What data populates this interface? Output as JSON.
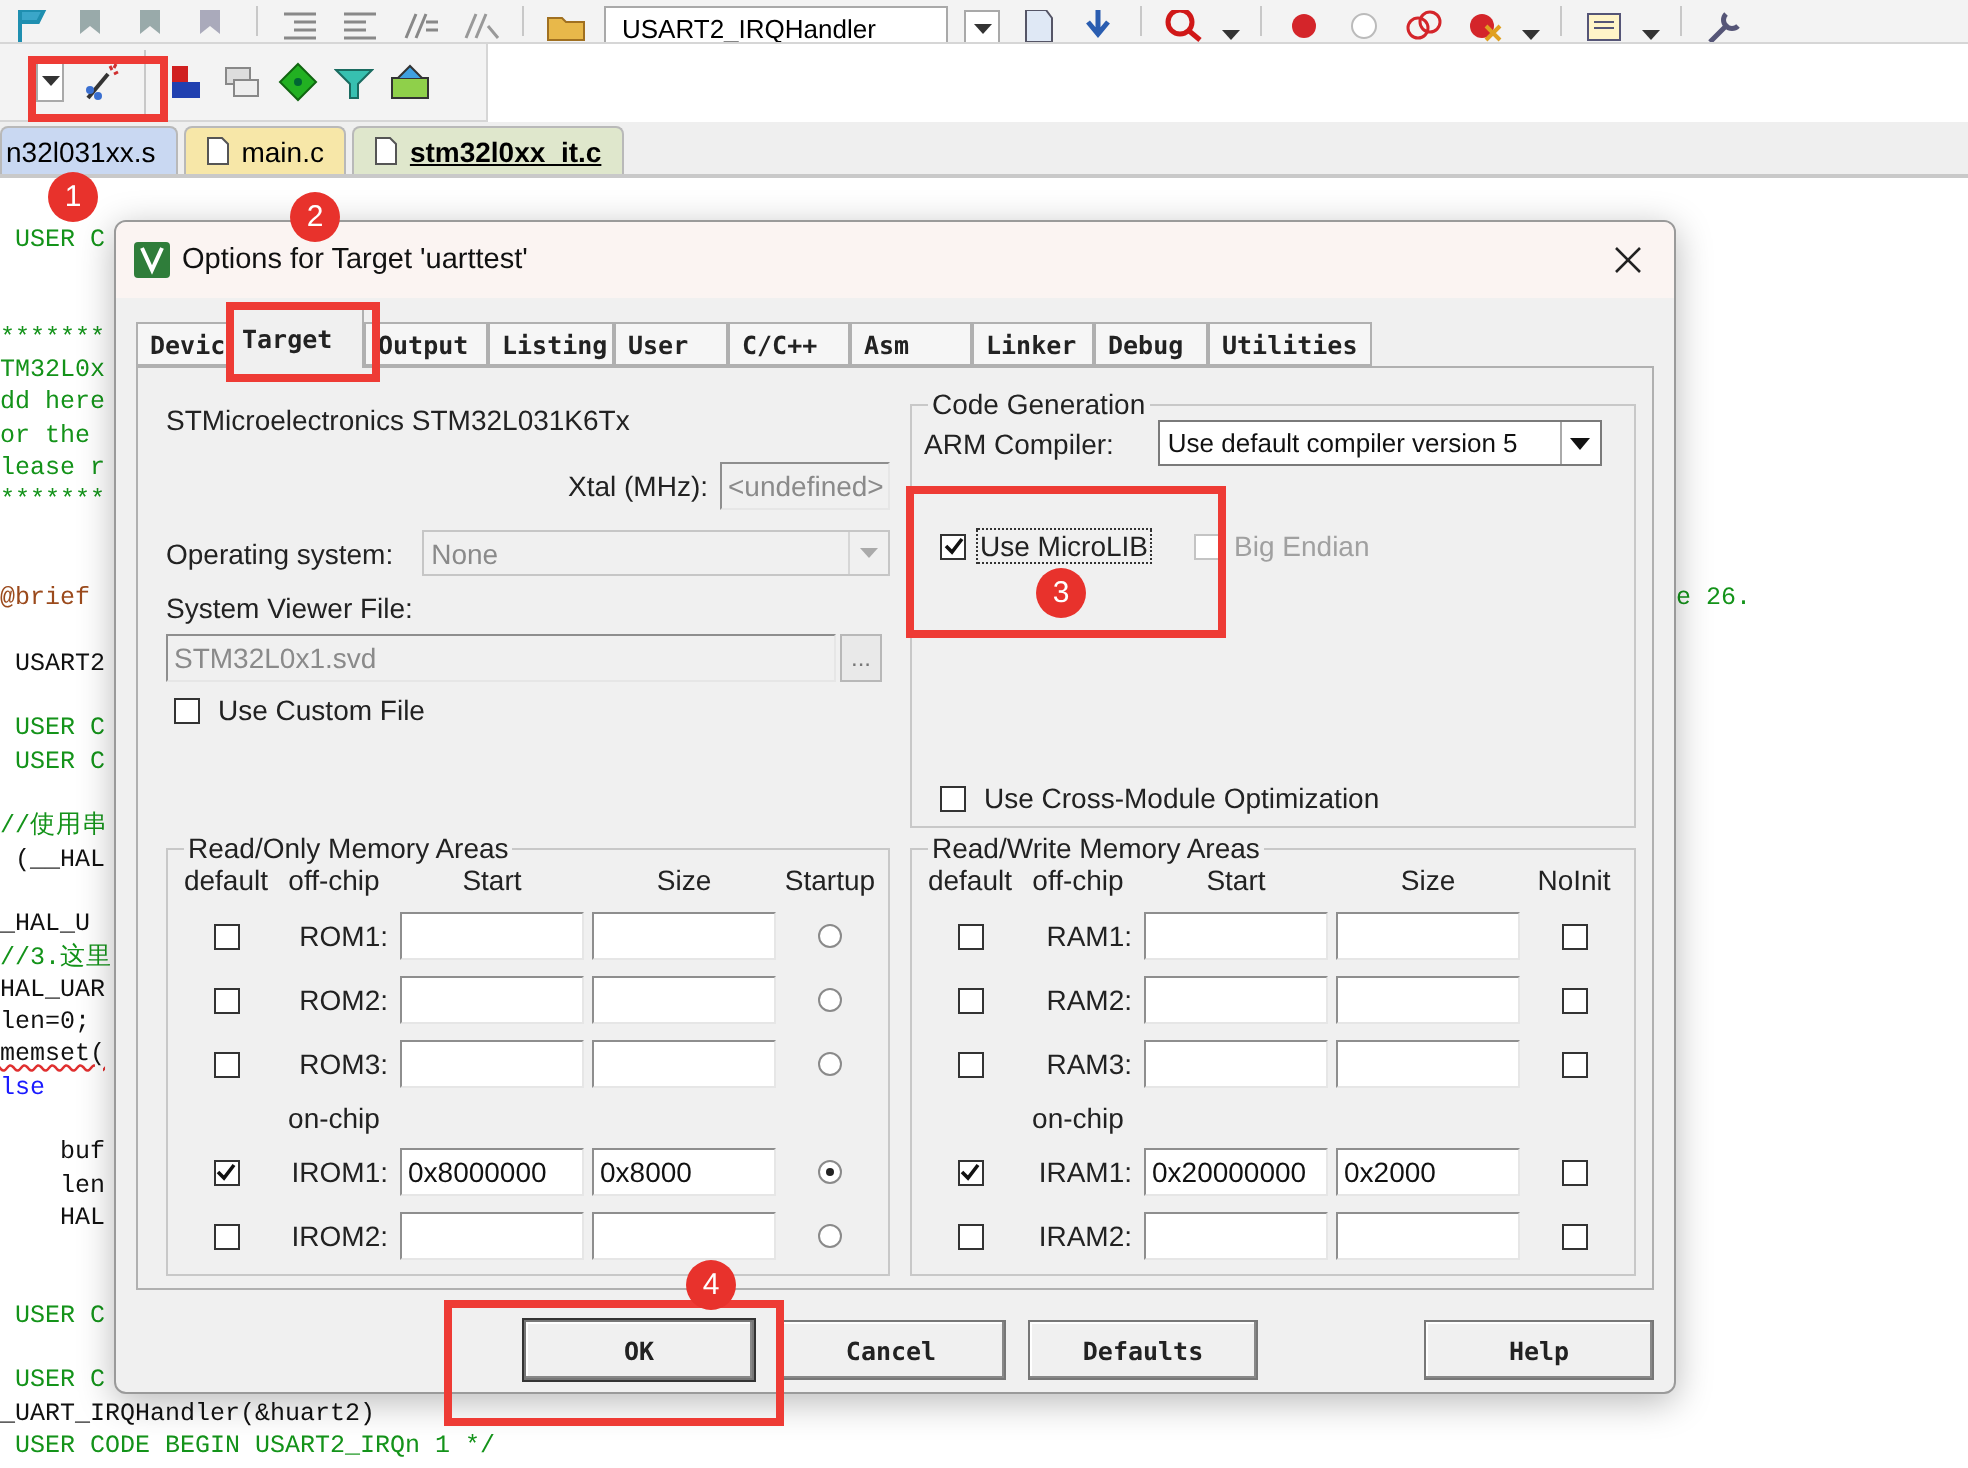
{
  "toolbar": {
    "function_box": "USART2_IRQHandler"
  },
  "file_tabs": [
    {
      "label": "n32l031xx.s",
      "selected": false,
      "color": "#c9d8f2"
    },
    {
      "label": "main.c",
      "selected": false,
      "color": "#f7e7a8"
    },
    {
      "label": "stm32l0xx_it.c",
      "selected": true,
      "color": "#dfe7cc"
    }
  ],
  "code_lines": [
    {
      "kind": "comment",
      "text": " USER C"
    },
    {
      "kind": "blank"
    },
    {
      "kind": "blank"
    },
    {
      "kind": "comment",
      "text": "*******"
    },
    {
      "kind": "comment",
      "text": "TM32L0x"
    },
    {
      "kind": "comment",
      "text": "dd here"
    },
    {
      "kind": "comment",
      "text": "or the"
    },
    {
      "kind": "comment",
      "text": "lease r"
    },
    {
      "kind": "comment",
      "text": "*******"
    },
    {
      "kind": "blank"
    },
    {
      "kind": "blank"
    },
    {
      "kind": "brief",
      "text": "@brief",
      "right_text": "e 26."
    },
    {
      "kind": "blank"
    },
    {
      "kind": "code",
      "text": " USART2"
    },
    {
      "kind": "blank"
    },
    {
      "kind": "comment",
      "text": " USER C"
    },
    {
      "kind": "comment",
      "text": " USER C"
    },
    {
      "kind": "blank"
    },
    {
      "kind": "comment",
      "text": "//使用串"
    },
    {
      "kind": "code",
      "text": " (__HAL"
    },
    {
      "kind": "blank"
    },
    {
      "kind": "code",
      "text": "_HAL_U"
    },
    {
      "kind": "comment",
      "text": "//3.这里"
    },
    {
      "kind": "code",
      "text": "HAL_UAR"
    },
    {
      "kind": "code",
      "text": "len=0;"
    },
    {
      "kind": "error",
      "text": "memset("
    },
    {
      "kind": "keyword",
      "text": "lse"
    },
    {
      "kind": "blank"
    },
    {
      "kind": "code",
      "text": "    buf"
    },
    {
      "kind": "code",
      "text": "    len"
    },
    {
      "kind": "code",
      "text": "    HAL"
    },
    {
      "kind": "blank"
    },
    {
      "kind": "blank"
    },
    {
      "kind": "comment",
      "text": " USER C"
    },
    {
      "kind": "blank"
    },
    {
      "kind": "comment",
      "text": " USER C"
    },
    {
      "kind": "code",
      "text": "_UART_IRQHandler(&huart2)"
    },
    {
      "kind": "comment",
      "text": " USER CODE BEGIN USART2_IRQn 1 */"
    }
  ],
  "dialog": {
    "title": "Options for Target 'uarttest'",
    "tabs": [
      {
        "label": "Devic",
        "selected": false
      },
      {
        "label": "Target",
        "selected": true
      },
      {
        "label": "Output",
        "selected": false
      },
      {
        "label": "Listing",
        "selected": false
      },
      {
        "label": "User",
        "selected": false
      },
      {
        "label": "C/C++",
        "selected": false
      },
      {
        "label": "Asm",
        "selected": false
      },
      {
        "label": "Linker",
        "selected": false
      },
      {
        "label": "Debug",
        "selected": false
      },
      {
        "label": "Utilities",
        "selected": false
      }
    ],
    "device": "STMicroelectronics STM32L031K6Tx",
    "xtal": {
      "label": "Xtal (MHz):",
      "value": "<undefined>",
      "disabled": true
    },
    "operating_system": {
      "label": "Operating system:",
      "value": "None",
      "disabled": true
    },
    "system_viewer": {
      "label": "System Viewer File:",
      "value": "STM32L0x1.svd",
      "disabled": true,
      "browse": "..."
    },
    "use_custom_file": {
      "label": "Use Custom File",
      "checked": false
    },
    "code_generation": {
      "title": "Code Generation",
      "compiler_label": "ARM Compiler:",
      "compiler": "Use default compiler version 5",
      "options": [
        {
          "label": "Use MicroLIB",
          "checked": true,
          "disabled": false,
          "focused": true
        },
        {
          "label": "Big Endian",
          "checked": false,
          "disabled": true,
          "focused": false
        }
      ],
      "cross_module": {
        "label": "Use Cross-Module Optimization",
        "checked": false
      }
    },
    "memory_groups": [
      {
        "kind": "rom",
        "title": "Read/Only Memory Areas",
        "headers": [
          "default",
          "off-chip",
          "Start",
          "Size",
          "Startup"
        ],
        "rows": [
          {
            "kind": "area",
            "label": "ROM1:",
            "default": false,
            "selected": false
          },
          {
            "kind": "area",
            "label": "ROM2:",
            "default": false,
            "selected": false
          },
          {
            "kind": "area",
            "label": "ROM3:",
            "default": false,
            "selected": false
          },
          {
            "kind": "section",
            "label": "on-chip"
          },
          {
            "kind": "area",
            "label": "IROM1:",
            "default": true,
            "start": "0x8000000",
            "size": "0x8000",
            "selected": true
          },
          {
            "kind": "area",
            "label": "IROM2:",
            "default": false,
            "selected": false
          }
        ]
      },
      {
        "kind": "ram",
        "title": "Read/Write Memory Areas",
        "headers": [
          "default",
          "off-chip",
          "Start",
          "Size",
          "NoInit"
        ],
        "rows": [
          {
            "kind": "area",
            "label": "RAM1:",
            "default": false,
            "no_init": false
          },
          {
            "kind": "area",
            "label": "RAM2:",
            "default": false,
            "no_init": false
          },
          {
            "kind": "area",
            "label": "RAM3:",
            "default": false,
            "no_init": false
          },
          {
            "kind": "section",
            "label": "on-chip"
          },
          {
            "kind": "area",
            "label": "IRAM1:",
            "default": true,
            "start": "0x20000000",
            "size": "0x2000",
            "no_init": false
          },
          {
            "kind": "area",
            "label": "IRAM2:",
            "default": false,
            "no_init": false
          }
        ]
      }
    ],
    "buttons": [
      {
        "label": "OK",
        "focused": true
      },
      {
        "label": "Cancel",
        "focused": false
      },
      {
        "label": "Defaults",
        "focused": false
      },
      {
        "label": "Help",
        "focused": false
      }
    ]
  },
  "annotations": [
    {
      "label": "1"
    },
    {
      "label": "2"
    },
    {
      "label": "3"
    },
    {
      "label": "4"
    }
  ]
}
